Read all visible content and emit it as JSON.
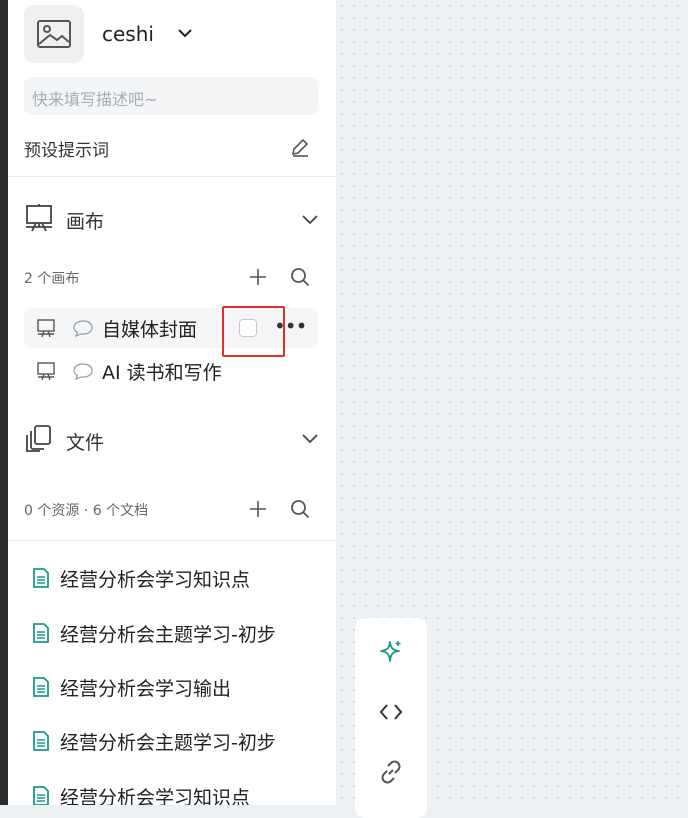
{
  "project": {
    "name": "ceshi",
    "description_placeholder": "快来填写描述吧~",
    "thumbnail_icon": "image-icon"
  },
  "preset": {
    "label": "预设提示词",
    "edit_icon": "pencil-icon"
  },
  "canvas_section": {
    "title": "画布",
    "count_text": "2 个画布",
    "items": [
      {
        "label": "自媒体封面",
        "active": true
      },
      {
        "label": "AI 读书和写作",
        "active": false
      }
    ]
  },
  "files_section": {
    "title": "文件",
    "count_text": "0 个资源 · 6 个文档",
    "documents": [
      {
        "label": "经营分析会学习知识点"
      },
      {
        "label": "经营分析会主题学习-初步"
      },
      {
        "label": "经营分析会学习输出"
      },
      {
        "label": "经营分析会主题学习-初步"
      },
      {
        "label": "经营分析会学习知识点"
      }
    ]
  },
  "toolbar": {
    "buttons": [
      "sparkle-icon",
      "code-icon",
      "link-icon"
    ]
  },
  "colors": {
    "accent": "#1a9a8a",
    "highlight": "#e0302a",
    "canvas_bg": "#eef2f4"
  }
}
